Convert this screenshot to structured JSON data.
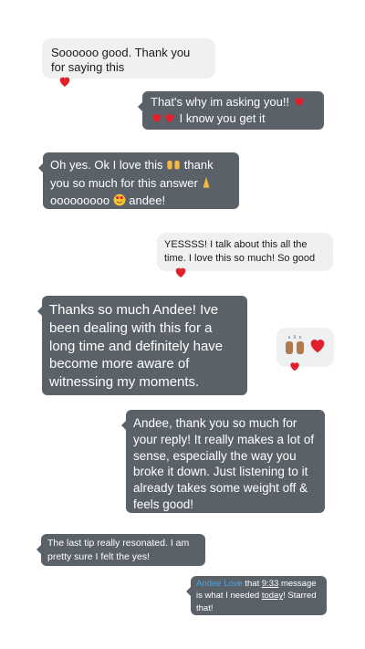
{
  "messages": [
    {
      "text": "Soooooo good. Thank you for saying this"
    },
    {
      "text_a": "That's why im asking you!! ",
      "text_b": " I know you get it"
    },
    {
      "text_a": "Oh yes. Ok I love this ",
      "text_b": " thank you so much for this answer ",
      "text_c": " ooooooooo ",
      "text_d": " andee!"
    },
    {
      "text": "YESSSS! I talk about this all the time. I love this so much! So good"
    },
    {
      "text": "Thanks so much Andee! Ive been dealing with this for a long time and definitely have become more aware of witnessing my moments."
    },
    {
      "text": "Andee, thank you so much for your reply! It really makes a lot of sense, especially the way you broke it down. Just listening to it already takes some weight off & feels good!"
    },
    {
      "text": "The last tip really resonated. I am pretty sure I felt the yes!"
    },
    {
      "name": "Andee Love",
      "t1": " that ",
      "time": "9:33",
      "t2": " message is what I needed ",
      "today": "today",
      "t3": "! Starred that!"
    }
  ],
  "colors": {
    "dark_bubble": "#5a6169",
    "light_bubble": "#eef0f2",
    "heart": "#e0202a",
    "link": "#4aa3df"
  }
}
